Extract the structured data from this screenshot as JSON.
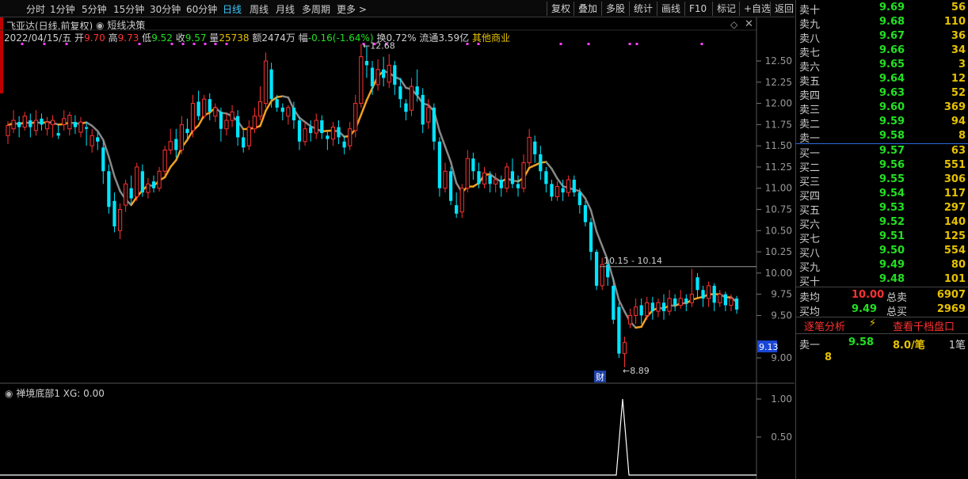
{
  "toolbar": {
    "periods": [
      "分时",
      "1分钟",
      "5分钟",
      "15分钟",
      "30分钟",
      "60分钟",
      "日线",
      "周线",
      "月线",
      "多周期",
      "更多"
    ],
    "active_period": "日线",
    "buttons": [
      "复权",
      "叠加",
      "多股",
      "统计",
      "画线",
      "F10",
      "标记",
      "+自选",
      "返回"
    ]
  },
  "header": {
    "stock_title": "飞亚达(日线,前复权)",
    "indicator_name": "短线决策",
    "date": "2022/04/15/五",
    "open_label": "开",
    "open": "9.70",
    "high_label": "高",
    "high": "9.73",
    "low_label": "低",
    "low": "9.52",
    "close_label": "收",
    "close": "9.57",
    "volume_label": "量",
    "volume": "25738",
    "amount_label": "额",
    "amount": "2474万",
    "change_label": "幅",
    "change": "-0.16(-1.64%)",
    "turnover_label": "换",
    "turnover": "0.72%",
    "float_label": "流通",
    "float": "3.59亿",
    "industry": "其他商业"
  },
  "chart_data": {
    "type": "candlestick",
    "ylim": [
      8.75,
      12.75
    ],
    "y_ticks": [
      "12.50",
      "12.25",
      "12.00",
      "11.75",
      "11.50",
      "11.25",
      "11.00",
      "10.75",
      "10.50",
      "10.25",
      "10.00",
      "9.75",
      "9.50",
      "9.00"
    ],
    "current_price_label": "9.13",
    "annotations": {
      "high_mark": "12.68",
      "low_mark": "8.89",
      "range_line": "10.15 - 10.14",
      "event_flag": "财"
    },
    "candles": [
      [
        11.62,
        11.74,
        11.52,
        11.79
      ],
      [
        11.7,
        11.8,
        11.65,
        11.92
      ],
      [
        11.78,
        11.72,
        11.6,
        11.85
      ],
      [
        11.72,
        11.85,
        11.68,
        11.9
      ],
      [
        11.8,
        11.72,
        11.6,
        11.88
      ],
      [
        11.68,
        11.8,
        11.62,
        11.92
      ],
      [
        11.82,
        11.75,
        11.68,
        11.88
      ],
      [
        11.7,
        11.78,
        11.62,
        11.84
      ],
      [
        11.75,
        11.8,
        11.6,
        11.86
      ],
      [
        11.65,
        11.62,
        11.58,
        11.74
      ],
      [
        11.75,
        11.82,
        11.68,
        11.92
      ],
      [
        11.7,
        11.86,
        11.62,
        11.9
      ],
      [
        11.78,
        11.72,
        11.64,
        11.86
      ],
      [
        11.66,
        11.78,
        11.6,
        11.84
      ],
      [
        11.72,
        11.7,
        11.5,
        11.78
      ],
      [
        11.5,
        11.62,
        11.42,
        11.7
      ],
      [
        11.6,
        11.55,
        11.45,
        11.66
      ],
      [
        11.48,
        11.2,
        11.05,
        11.56
      ],
      [
        11.2,
        10.78,
        10.7,
        11.28
      ],
      [
        10.85,
        10.55,
        10.48,
        10.95
      ],
      [
        10.5,
        10.75,
        10.4,
        10.82
      ],
      [
        10.8,
        11.05,
        10.72,
        11.1
      ],
      [
        11.0,
        10.88,
        10.8,
        11.15
      ],
      [
        10.9,
        11.25,
        10.85,
        11.3
      ],
      [
        11.2,
        10.95,
        10.9,
        11.28
      ],
      [
        10.95,
        11.05,
        10.88,
        11.12
      ],
      [
        11.08,
        11.0,
        10.95,
        11.15
      ],
      [
        11.0,
        11.2,
        10.96,
        11.25
      ],
      [
        11.2,
        11.45,
        11.15,
        11.5
      ],
      [
        11.45,
        11.55,
        11.4,
        11.7
      ],
      [
        11.58,
        11.45,
        11.36,
        11.7
      ],
      [
        11.45,
        11.75,
        11.4,
        11.85
      ],
      [
        11.7,
        11.65,
        11.55,
        11.82
      ],
      [
        11.68,
        12.0,
        11.6,
        12.1
      ],
      [
        12.02,
        11.85,
        11.8,
        12.15
      ],
      [
        11.85,
        12.05,
        11.82,
        12.1
      ],
      [
        12.05,
        11.9,
        11.8,
        12.12
      ],
      [
        11.85,
        11.95,
        11.78,
        12.0
      ],
      [
        11.9,
        11.7,
        11.55,
        11.95
      ],
      [
        11.7,
        11.8,
        11.62,
        11.88
      ],
      [
        11.8,
        11.9,
        11.72,
        11.98
      ],
      [
        11.85,
        11.6,
        11.5,
        11.92
      ],
      [
        11.6,
        11.48,
        11.42,
        11.68
      ],
      [
        11.5,
        11.72,
        11.45,
        11.8
      ],
      [
        11.7,
        11.85,
        11.65,
        11.95
      ],
      [
        11.85,
        12.02,
        11.8,
        12.2
      ],
      [
        12.0,
        12.5,
        11.95,
        12.6
      ],
      [
        12.4,
        12.05,
        11.95,
        12.48
      ],
      [
        12.05,
        11.95,
        11.9,
        12.1
      ],
      [
        11.95,
        11.9,
        11.8,
        12.0
      ],
      [
        11.85,
        11.95,
        11.75,
        11.98
      ],
      [
        11.95,
        11.8,
        11.7,
        12.02
      ],
      [
        11.8,
        11.55,
        11.45,
        11.85
      ],
      [
        11.55,
        11.7,
        11.5,
        11.78
      ],
      [
        11.72,
        11.65,
        11.55,
        11.8
      ],
      [
        11.65,
        11.8,
        11.58,
        11.88
      ],
      [
        11.8,
        11.65,
        11.58,
        11.86
      ],
      [
        11.62,
        11.58,
        11.45,
        11.68
      ],
      [
        11.58,
        11.72,
        11.5,
        11.78
      ],
      [
        11.72,
        11.6,
        11.52,
        11.8
      ],
      [
        11.55,
        11.48,
        11.4,
        11.62
      ],
      [
        11.5,
        11.7,
        11.45,
        11.78
      ],
      [
        11.68,
        12.0,
        11.6,
        12.1
      ],
      [
        12.0,
        12.55,
        11.95,
        12.7
      ],
      [
        12.5,
        12.45,
        12.3,
        12.68
      ],
      [
        12.42,
        12.2,
        12.1,
        12.5
      ],
      [
        12.22,
        12.4,
        12.15,
        12.52
      ],
      [
        12.4,
        12.3,
        12.2,
        12.55
      ],
      [
        12.25,
        12.45,
        12.18,
        12.58
      ],
      [
        12.45,
        12.22,
        12.1,
        12.5
      ],
      [
        12.2,
        12.05,
        11.95,
        12.3
      ],
      [
        12.0,
        11.9,
        11.8,
        12.05
      ],
      [
        11.92,
        12.2,
        11.85,
        12.3
      ],
      [
        12.2,
        12.1,
        12.02,
        12.4
      ],
      [
        12.1,
        11.75,
        11.65,
        12.18
      ],
      [
        11.78,
        11.95,
        11.7,
        12.05
      ],
      [
        11.95,
        11.55,
        11.45,
        12.0
      ],
      [
        11.55,
        11.0,
        10.9,
        11.6
      ],
      [
        11.0,
        11.2,
        10.95,
        11.3
      ],
      [
        11.2,
        10.85,
        10.8,
        11.25
      ],
      [
        10.8,
        10.7,
        10.65,
        10.95
      ],
      [
        10.72,
        11.0,
        10.65,
        11.05
      ],
      [
        11.0,
        11.35,
        10.95,
        11.45
      ],
      [
        11.35,
        11.2,
        11.1,
        11.42
      ],
      [
        11.2,
        11.05,
        11.0,
        11.3
      ],
      [
        11.05,
        11.18,
        11.0,
        11.25
      ],
      [
        11.15,
        11.05,
        10.95,
        11.2
      ],
      [
        11.05,
        11.1,
        10.95,
        11.18
      ],
      [
        11.1,
        11.0,
        10.9,
        11.15
      ],
      [
        11.0,
        11.25,
        10.95,
        11.3
      ],
      [
        11.2,
        11.05,
        11.0,
        11.35
      ],
      [
        11.05,
        11.0,
        10.9,
        11.15
      ],
      [
        11.0,
        11.3,
        10.95,
        11.4
      ],
      [
        11.3,
        11.6,
        11.25,
        11.7
      ],
      [
        11.55,
        11.4,
        11.3,
        11.62
      ],
      [
        11.4,
        11.2,
        11.1,
        11.5
      ],
      [
        11.2,
        11.05,
        10.95,
        11.25
      ],
      [
        11.05,
        10.9,
        10.85,
        11.1
      ],
      [
        10.9,
        11.02,
        10.85,
        11.08
      ],
      [
        11.0,
        10.95,
        10.85,
        11.1
      ],
      [
        10.95,
        11.1,
        10.9,
        11.15
      ],
      [
        11.1,
        10.95,
        10.9,
        11.15
      ],
      [
        10.95,
        10.8,
        10.7,
        11.0
      ],
      [
        10.8,
        10.6,
        10.55,
        10.85
      ],
      [
        10.6,
        10.25,
        10.15,
        10.65
      ],
      [
        10.25,
        9.85,
        9.8,
        10.28
      ],
      [
        9.85,
        10.1,
        9.8,
        10.18
      ],
      [
        10.1,
        9.95,
        9.85,
        10.15
      ],
      [
        9.85,
        9.45,
        9.4,
        9.95
      ],
      [
        9.6,
        9.05,
        9.0,
        9.65
      ],
      [
        9.05,
        9.18,
        8.89,
        9.25
      ],
      [
        9.4,
        9.5,
        9.35,
        9.58
      ],
      [
        9.5,
        9.6,
        9.4,
        9.7
      ],
      [
        9.62,
        9.5,
        9.4,
        9.7
      ],
      [
        9.5,
        9.65,
        9.45,
        9.72
      ],
      [
        9.65,
        9.55,
        9.45,
        9.72
      ],
      [
        9.55,
        9.65,
        9.48,
        9.7
      ],
      [
        9.65,
        9.55,
        9.45,
        9.75
      ],
      [
        9.55,
        9.7,
        9.5,
        9.8
      ],
      [
        9.7,
        9.62,
        9.55,
        9.75
      ],
      [
        9.62,
        9.7,
        9.58,
        9.8
      ],
      [
        9.7,
        9.65,
        9.55,
        9.75
      ],
      [
        9.65,
        9.75,
        9.6,
        10.05
      ],
      [
        9.95,
        9.8,
        9.7,
        10.0
      ],
      [
        9.8,
        9.7,
        9.6,
        9.85
      ],
      [
        9.7,
        9.85,
        9.6,
        9.9
      ],
      [
        9.85,
        9.65,
        9.55,
        9.88
      ],
      [
        9.65,
        9.75,
        9.6,
        9.8
      ],
      [
        9.75,
        9.62,
        9.55,
        9.78
      ],
      [
        9.62,
        9.7,
        9.55,
        9.75
      ],
      [
        9.7,
        9.57,
        9.52,
        9.73
      ]
    ],
    "sub_indicator": {
      "name": "禅境底部1",
      "xg_label": "XG:",
      "xg_value": "0.00",
      "y_ticks": [
        "1.00",
        "0.50"
      ],
      "signal_bar_value": 1
    }
  },
  "orderbook": {
    "asks": [
      {
        "label": "卖十",
        "price": "9.69",
        "vol": "56"
      },
      {
        "label": "卖九",
        "price": "9.68",
        "vol": "110"
      },
      {
        "label": "卖八",
        "price": "9.67",
        "vol": "36"
      },
      {
        "label": "卖七",
        "price": "9.66",
        "vol": "34"
      },
      {
        "label": "卖六",
        "price": "9.65",
        "vol": "3"
      },
      {
        "label": "卖五",
        "price": "9.64",
        "vol": "12"
      },
      {
        "label": "卖四",
        "price": "9.63",
        "vol": "52"
      },
      {
        "label": "卖三",
        "price": "9.60",
        "vol": "369"
      },
      {
        "label": "卖二",
        "price": "9.59",
        "vol": "94"
      },
      {
        "label": "卖一",
        "price": "9.58",
        "vol": "8"
      }
    ],
    "bids": [
      {
        "label": "买一",
        "price": "9.57",
        "vol": "63"
      },
      {
        "label": "买二",
        "price": "9.56",
        "vol": "551"
      },
      {
        "label": "买三",
        "price": "9.55",
        "vol": "306"
      },
      {
        "label": "买四",
        "price": "9.54",
        "vol": "117"
      },
      {
        "label": "买五",
        "price": "9.53",
        "vol": "297"
      },
      {
        "label": "买六",
        "price": "9.52",
        "vol": "140"
      },
      {
        "label": "买七",
        "price": "9.51",
        "vol": "125"
      },
      {
        "label": "买八",
        "price": "9.50",
        "vol": "554"
      },
      {
        "label": "买九",
        "price": "9.49",
        "vol": "80"
      },
      {
        "label": "买十",
        "price": "9.48",
        "vol": "101"
      }
    ],
    "avg_ask_label": "卖均",
    "avg_ask": "10.00",
    "total_ask_label": "总卖",
    "total_ask": "6907",
    "avg_bid_label": "买均",
    "avg_bid": "9.49",
    "total_bid_label": "总买",
    "total_bid": "2969",
    "tick_analysis": "逐笔分析",
    "view_depth": "查看千档盘口",
    "tick_label": "卖一",
    "tick_price": "9.58",
    "tick_amount": "8.0/笔",
    "tick_count": "1笔",
    "tick_extra": "8",
    "colors": {
      "up": "#ff3232",
      "down": "#22e022",
      "vol": "#e6c200",
      "ma": "#f0a020",
      "ma_grey": "#888888",
      "cyan": "#00e5ff"
    }
  }
}
